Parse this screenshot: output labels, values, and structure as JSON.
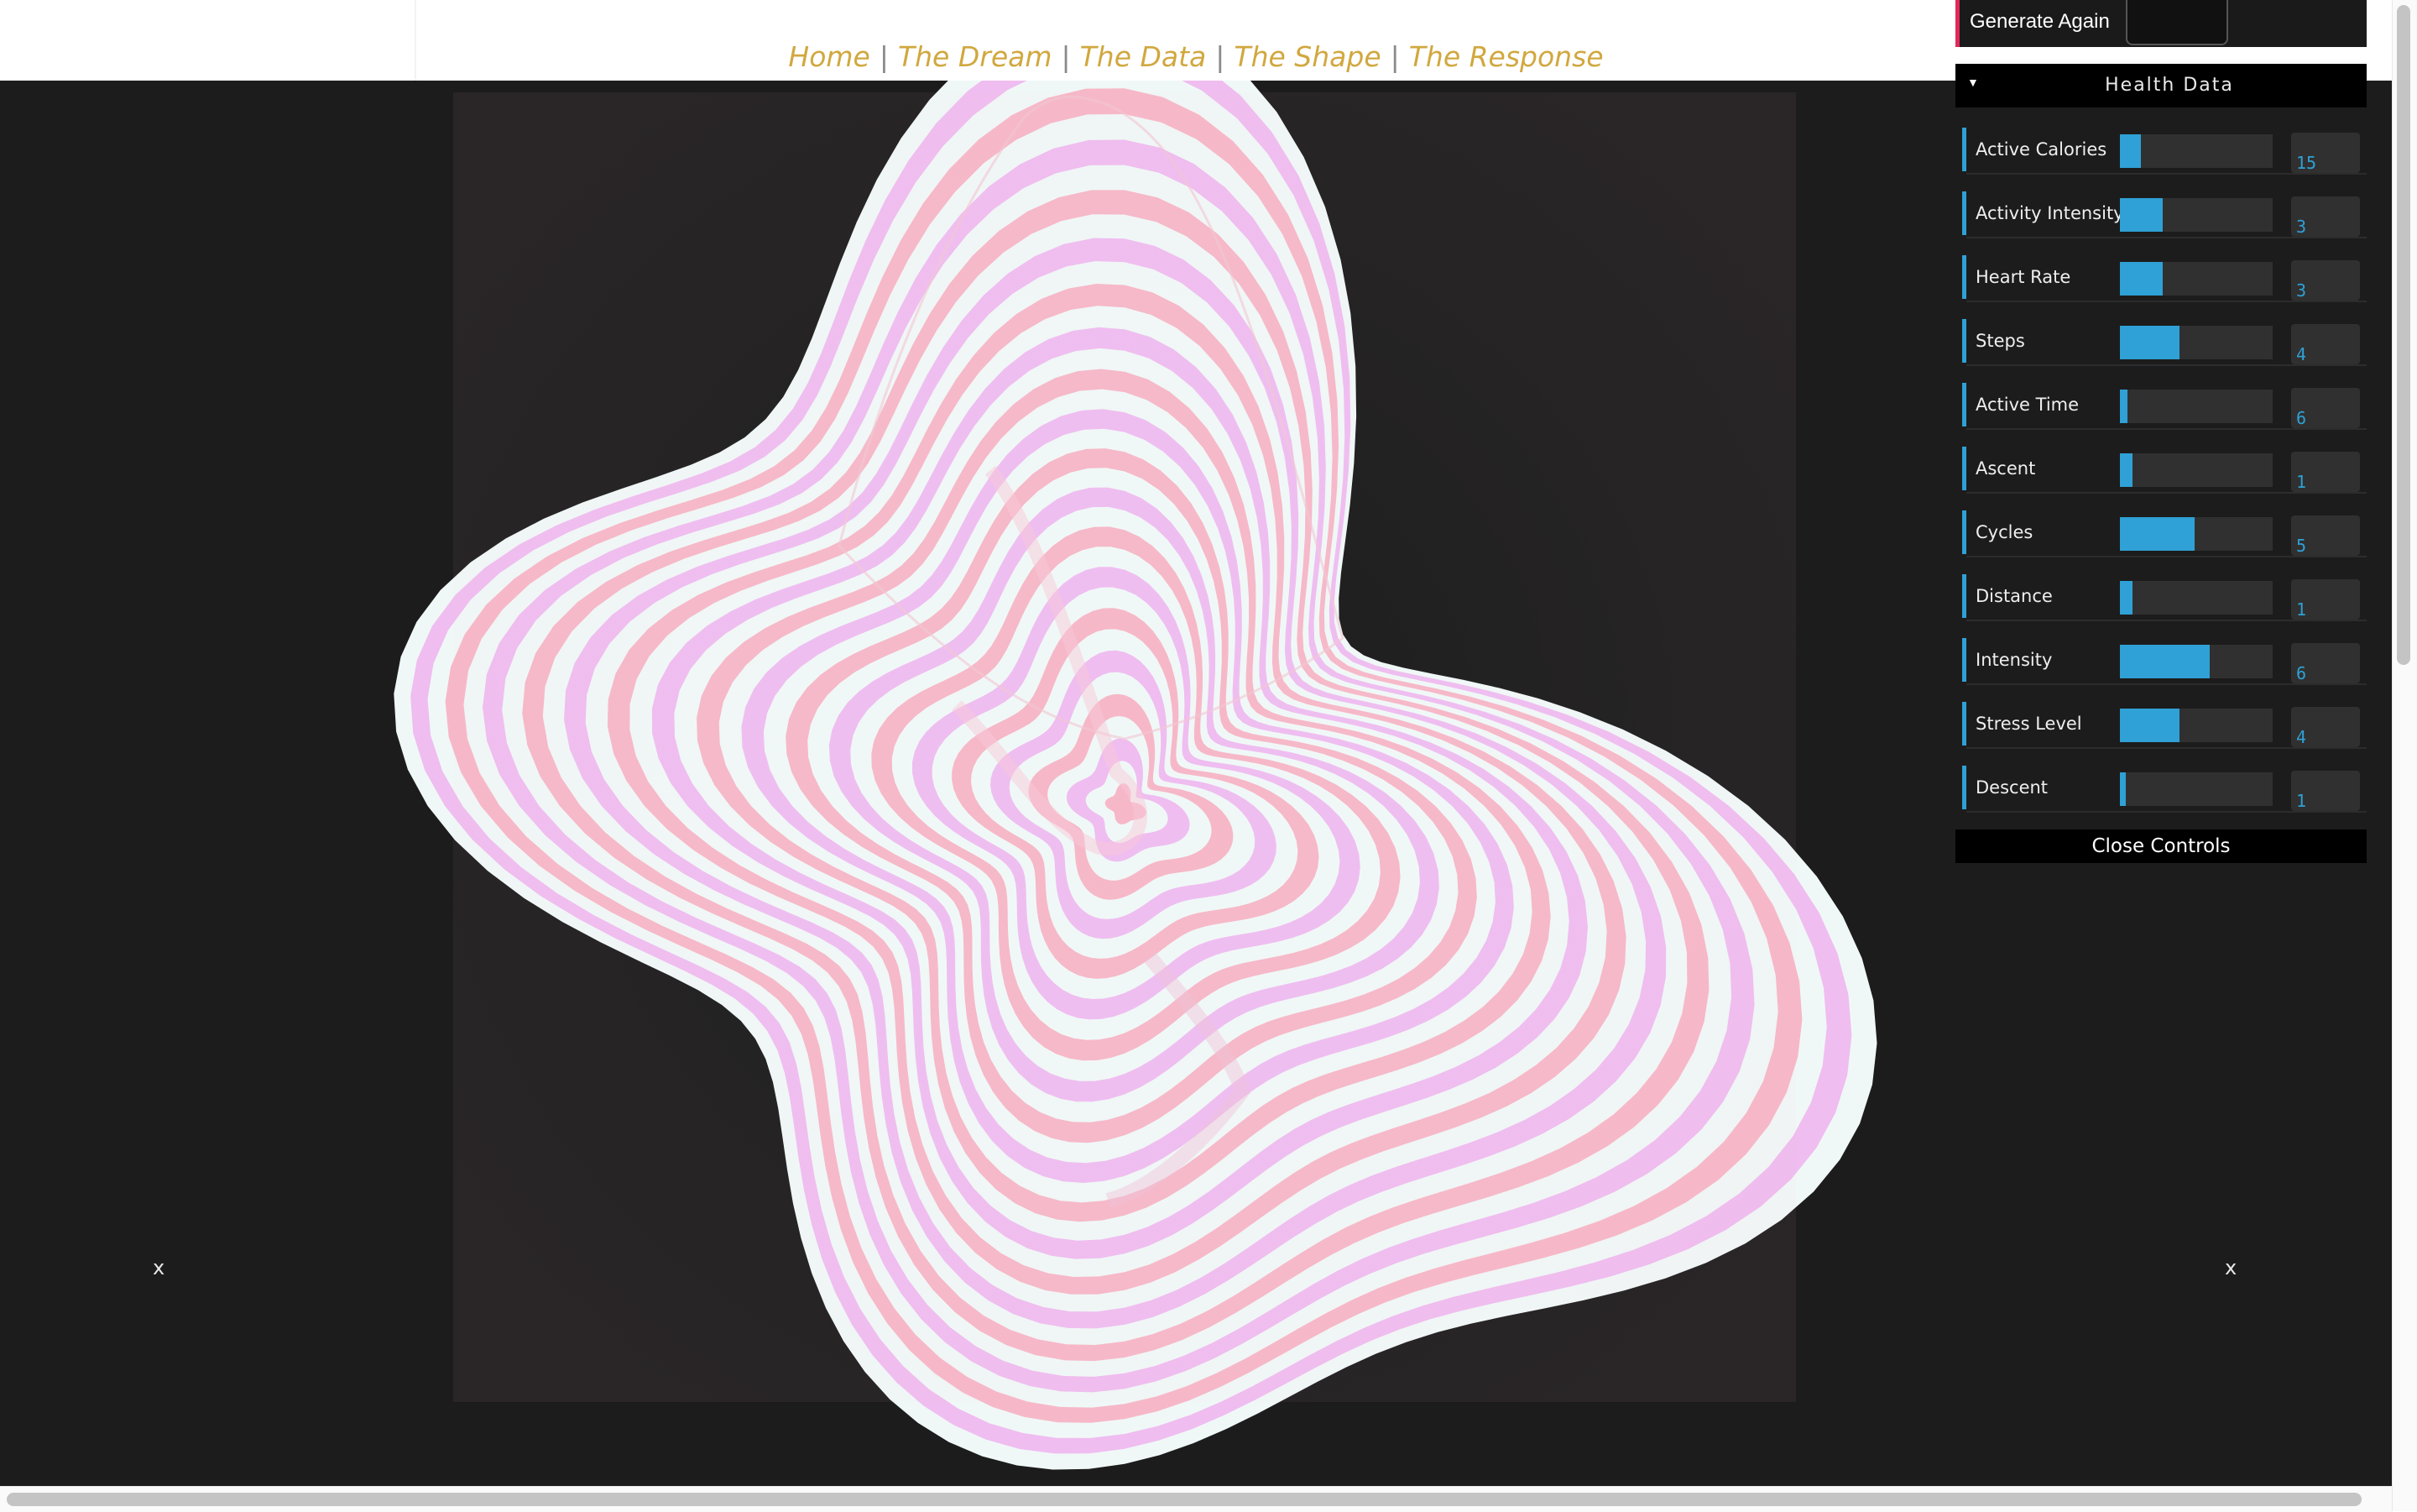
{
  "nav": {
    "items": [
      "Home",
      "The Dream",
      "The Data",
      "The Shape",
      "The Response"
    ],
    "separator": "|"
  },
  "canvas": {
    "left_close": "x",
    "right_close": "x",
    "stripe_colors": [
      "#f6b8c8",
      "#f0f8f7",
      "#efbdf0"
    ]
  },
  "controls": {
    "generate_label": "Generate Again",
    "folder_label": "Health Data",
    "close_label": "Close Controls",
    "accent_color": "#2fa1d6",
    "rows": [
      {
        "label": "Active Calories",
        "value": "15",
        "fill": 0.14
      },
      {
        "label": "Activity Intensity",
        "value": "3",
        "fill": 0.28
      },
      {
        "label": "Heart Rate",
        "value": "3",
        "fill": 0.28
      },
      {
        "label": "Steps",
        "value": "4",
        "fill": 0.39
      },
      {
        "label": "Active Time",
        "value": "6",
        "fill": 0.05
      },
      {
        "label": "Ascent",
        "value": "1",
        "fill": 0.08
      },
      {
        "label": "Cycles",
        "value": "5",
        "fill": 0.49
      },
      {
        "label": "Distance",
        "value": "1",
        "fill": 0.08
      },
      {
        "label": "Intensity",
        "value": "6",
        "fill": 0.59
      },
      {
        "label": "Stress Level",
        "value": "4",
        "fill": 0.39
      },
      {
        "label": "Descent",
        "value": "1",
        "fill": 0.04
      }
    ]
  }
}
